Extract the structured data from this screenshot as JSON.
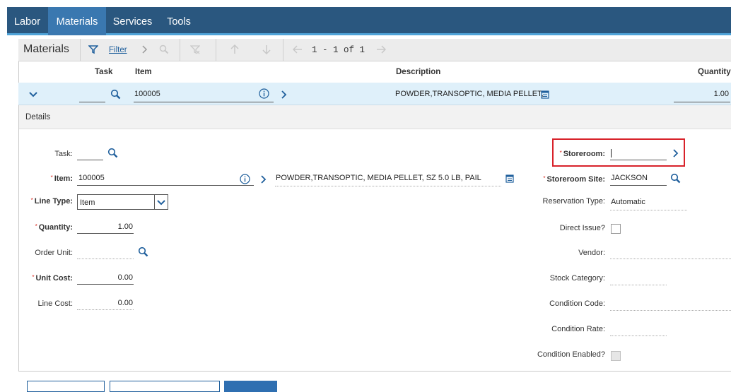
{
  "tabs": [
    {
      "label": "Labor"
    },
    {
      "label": "Materials"
    },
    {
      "label": "Services"
    },
    {
      "label": "Tools"
    }
  ],
  "toolbar": {
    "title": "Materials",
    "filter_label": "Filter",
    "pager": "1 - 1 of 1"
  },
  "columns": {
    "task": "Task",
    "item": "Item",
    "description": "Description",
    "quantity": "Quantity"
  },
  "row": {
    "task": "",
    "item": "100005",
    "description": "POWDER,TRANSOPTIC, MEDIA PELLET,",
    "quantity": "1.00"
  },
  "details": {
    "title": "Details",
    "task_label": "Task:",
    "task_value": "",
    "item_label": "Item:",
    "item_value": "100005",
    "item_description": "POWDER,TRANSOPTIC, MEDIA PELLET, SZ 5.0 LB, PAIL",
    "line_type_label": "Line Type:",
    "line_type_value": "Item",
    "quantity_label": "Quantity:",
    "quantity_value": "1.00",
    "order_unit_label": "Order Unit:",
    "order_unit_value": "",
    "unit_cost_label": "Unit Cost:",
    "unit_cost_value": "0.00",
    "line_cost_label": "Line Cost:",
    "line_cost_value": "0.00",
    "storeroom_label": "Storeroom:",
    "storeroom_value": "",
    "storeroom_site_label": "Storeroom Site:",
    "storeroom_site_value": "JACKSON",
    "reservation_type_label": "Reservation Type:",
    "reservation_type_value": "Automatic",
    "direct_issue_label": "Direct Issue?",
    "vendor_label": "Vendor:",
    "vendor_value": "",
    "stock_category_label": "Stock Category:",
    "stock_category_value": "",
    "condition_code_label": "Condition Code:",
    "condition_code_value": "",
    "condition_rate_label": "Condition Rate:",
    "condition_rate_value": "",
    "condition_enabled_label": "Condition Enabled?"
  },
  "colors": {
    "tabbar": "#2a577f",
    "tab_active": "#3a78b0",
    "accent": "#1f5f9c",
    "row_selected": "#dff0fa",
    "required": "#d9281e",
    "highlight": "#d8222a"
  },
  "icons": [
    "filter-icon",
    "chevron-right-icon",
    "search-icon",
    "clear-filter-icon",
    "arrow-up-icon",
    "arrow-down-icon",
    "arrow-left-icon",
    "arrow-right-icon",
    "chevron-down-icon",
    "info-icon",
    "long-description-icon",
    "dropdown-arrow-icon"
  ]
}
